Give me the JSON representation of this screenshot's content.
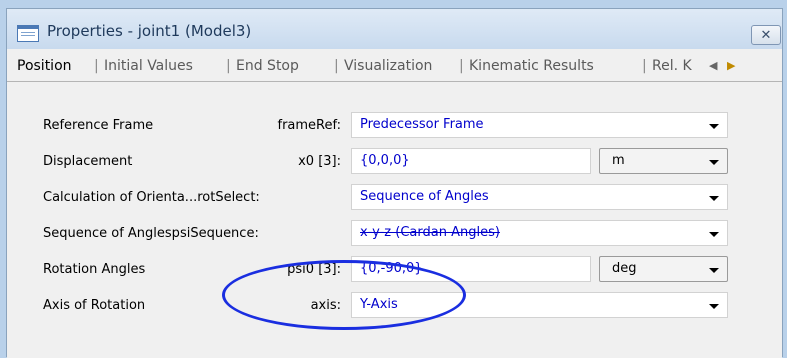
{
  "window": {
    "title": "Properties - joint1 (Model3)",
    "close_glyph": "✕"
  },
  "tabs": [
    {
      "label": "Position",
      "active": true
    },
    {
      "label": "Initial Values"
    },
    {
      "label": "End Stop"
    },
    {
      "label": "Visualization"
    },
    {
      "label": "Kinematic Results"
    },
    {
      "label": "Rel. K"
    }
  ],
  "tab_separator": "|",
  "tab_scroll": {
    "left": "◀",
    "right": "▶"
  },
  "rows": [
    {
      "label": "Reference Frame",
      "variable": "frameRef:",
      "value": "Predecessor Frame",
      "control": "dropdown"
    },
    {
      "label": "Displacement",
      "variable": "x0 [3]:",
      "value": "{0,0,0}",
      "control": "text+unit",
      "unit": "m"
    },
    {
      "label": "Calculation of Orienta...rotSelect:",
      "variable": "",
      "value": "Sequence of Angles",
      "control": "dropdown"
    },
    {
      "label": "Sequence of AnglespsiSequence:",
      "variable": "",
      "value": "x-y-z (Cardan Angles)",
      "control": "dropdown"
    },
    {
      "label": "Rotation Angles",
      "variable": "psi0 [3]:",
      "value": "{0,-90,0}",
      "control": "text+unit",
      "unit": "deg"
    },
    {
      "label": "Axis of Rotation",
      "variable": "axis:",
      "value": "Y-Axis",
      "control": "dropdown"
    }
  ],
  "annotation": {
    "shape": "ellipse",
    "color": "#1a2ee0",
    "highlights": "psi0 [3]: {0,-90,0}"
  },
  "colors": {
    "value_text": "#0000cc",
    "background": "#f0f0f0",
    "title_text": "#1e395b"
  }
}
